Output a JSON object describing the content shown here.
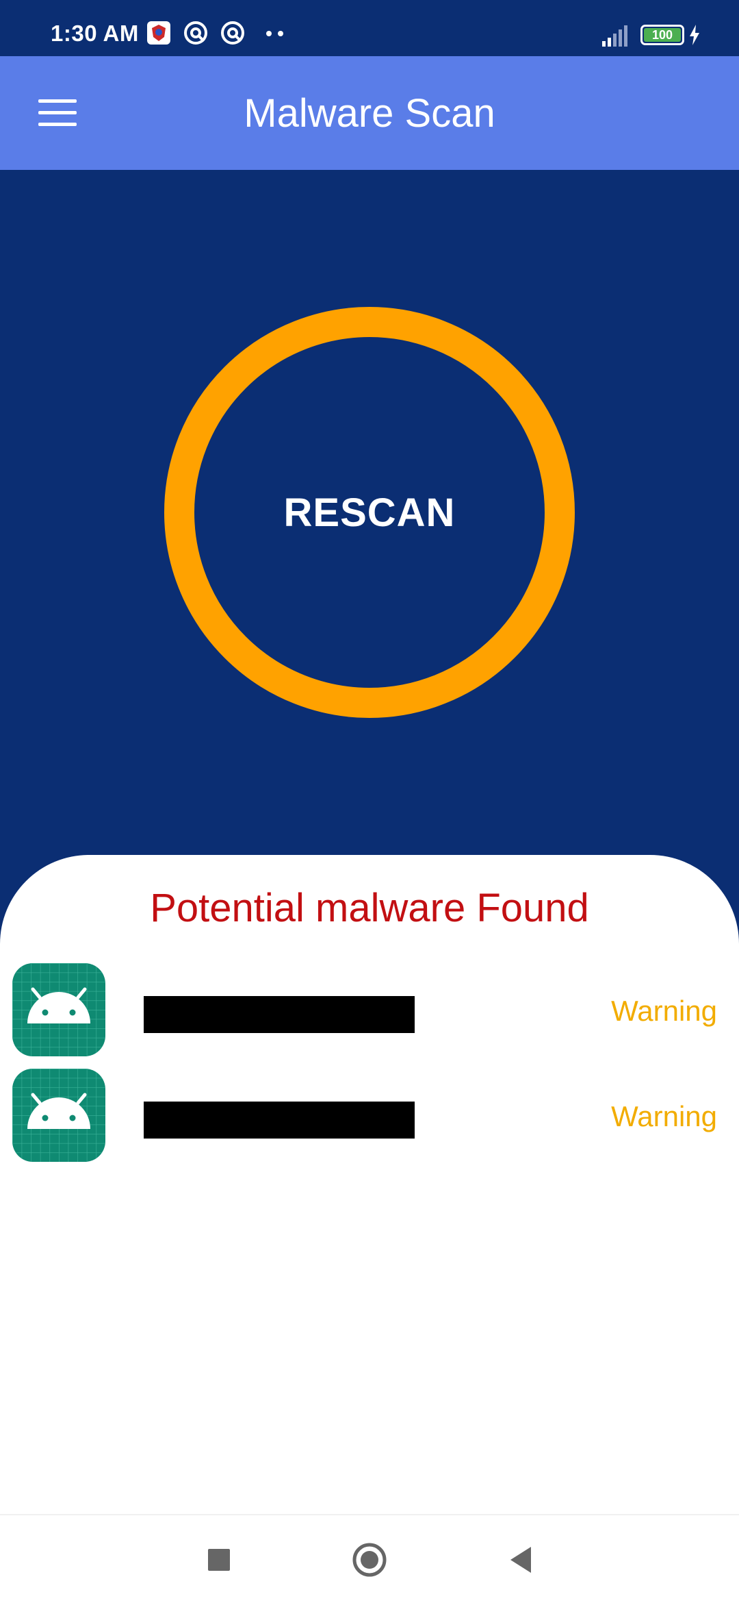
{
  "status_bar": {
    "time": "1:30 AM",
    "battery": "100",
    "icons": [
      "app-badge-icon",
      "sync-icon",
      "sync-icon",
      "more-dots-icon",
      "signal-icon",
      "battery-icon",
      "charging-icon"
    ]
  },
  "app_bar": {
    "title": "Malware Scan",
    "menu_icon": "hamburger-menu-icon"
  },
  "scan": {
    "button_label": "RESCAN",
    "ring_color": "#ffa200"
  },
  "results": {
    "title": "Potential malware Found",
    "items": [
      {
        "icon": "android-app-icon",
        "status": "Warning"
      },
      {
        "icon": "android-app-icon",
        "status": "Warning"
      }
    ]
  },
  "nav_bar": {
    "icons": [
      "recents-square-icon",
      "home-circle-icon",
      "back-triangle-icon"
    ]
  },
  "colors": {
    "background": "#0b2e73",
    "app_bar": "#5a7de8",
    "accent": "#ffa200",
    "danger": "#c20f12",
    "warning": "#f2ac00"
  }
}
